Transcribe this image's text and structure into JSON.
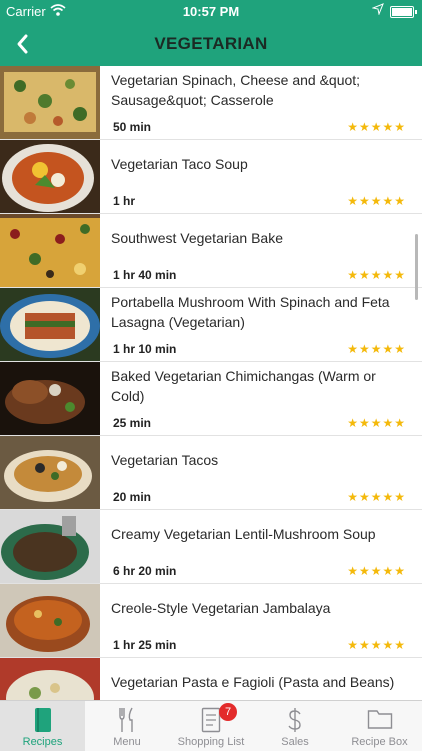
{
  "status": {
    "carrier": "Carrier",
    "time": "10:57 PM"
  },
  "header": {
    "title": "VEGETARIAN"
  },
  "recipes": [
    {
      "title": "Vegetarian Spinach, Cheese and &quot; Sausage&quot; Casserole",
      "time": "50 min",
      "rating": "★★★★★"
    },
    {
      "title": "Vegetarian Taco Soup",
      "time": "1 hr",
      "rating": "★★★★★"
    },
    {
      "title": "Southwest Vegetarian Bake",
      "time": "1 hr 40 min",
      "rating": "★★★★★"
    },
    {
      "title": "Portabella Mushroom With Spinach and Feta Lasagna (Vegetarian)",
      "time": "1 hr 10 min",
      "rating": "★★★★★"
    },
    {
      "title": "Baked Vegetarian Chimichangas (Warm or Cold)",
      "time": "25 min",
      "rating": "★★★★★"
    },
    {
      "title": "Vegetarian Tacos",
      "time": "20 min",
      "rating": "★★★★★"
    },
    {
      "title": "Creamy Vegetarian Lentil-Mushroom Soup",
      "time": "6 hr 20 min",
      "rating": "★★★★★"
    },
    {
      "title": "Creole-Style Vegetarian Jambalaya",
      "time": "1 hr 25 min",
      "rating": "★★★★★"
    },
    {
      "title": "Vegetarian Pasta e Fagioli (Pasta and Beans)",
      "time": "",
      "rating": ""
    }
  ],
  "tabs": [
    {
      "label": "Recipes",
      "icon": "recipe-book-icon",
      "active": true
    },
    {
      "label": "Menu",
      "icon": "fork-knife-icon"
    },
    {
      "label": "Shopping List",
      "icon": "shopping-list-icon",
      "badge": "7"
    },
    {
      "label": "Sales",
      "icon": "dollar-icon"
    },
    {
      "label": "Recipe Box",
      "icon": "folder-icon"
    }
  ],
  "colors": {
    "brand": "#1fa37c",
    "star": "#f4b90b",
    "badge": "#e32b2b"
  }
}
